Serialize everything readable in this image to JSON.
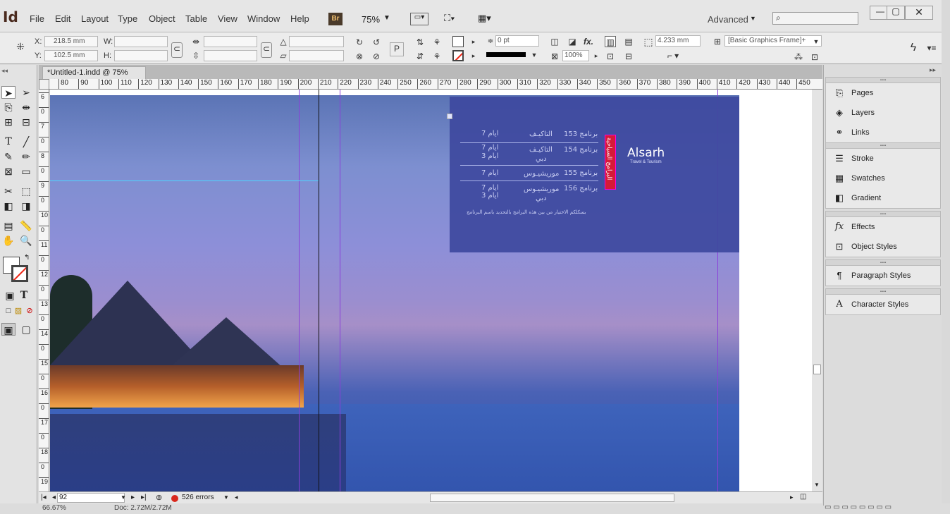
{
  "app": {
    "logo": "Id"
  },
  "menu": [
    "File",
    "Edit",
    "Layout",
    "Type",
    "Object",
    "Table",
    "View",
    "Window",
    "Help"
  ],
  "bridge_label": "Br",
  "zoom": "75%",
  "workspace": "Advanced",
  "control": {
    "x_label": "X:",
    "x_value": "218.5 mm",
    "y_label": "Y:",
    "y_value": "102.5 mm",
    "w_label": "W:",
    "h_label": "H:",
    "stroke_weight": "0 pt",
    "fit_value": "4.233 mm",
    "zoom_percent": "100%",
    "object_style": "[Basic Graphics Frame]+"
  },
  "document_tab": "*Untitled-1.indd @ 75%",
  "ruler": {
    "horizontal": [
      "80",
      "90",
      "100",
      "110",
      "120",
      "130",
      "140",
      "150",
      "160",
      "170",
      "180",
      "190",
      "200",
      "210",
      "220",
      "230",
      "240",
      "250",
      "260",
      "270",
      "280",
      "290",
      "300",
      "310",
      "320",
      "330",
      "340",
      "350",
      "360",
      "370",
      "380",
      "390",
      "400",
      "410",
      "420",
      "430",
      "440",
      "450"
    ],
    "vertical": [
      "6",
      "0",
      "7",
      "0",
      "8",
      "0",
      "9",
      "0",
      "10",
      "0",
      "11",
      "0",
      "12",
      "0",
      "13",
      "0",
      "14",
      "0",
      "15",
      "0",
      "16",
      "0",
      "17",
      "0",
      "18",
      "0",
      "19",
      "0"
    ]
  },
  "artwork": {
    "brand": "Alsarh",
    "brand_sub": "Travel & Tourism",
    "rows": [
      {
        "program": "برنامج 153",
        "place": "التاكيـف",
        "duration": "7 ايام"
      },
      {
        "program": "برنامج 154",
        "place": "التاكيـف",
        "duration": "7 ايام"
      },
      {
        "program": "برنامج 155",
        "place": "موريشيـوس",
        "duration": "7 ايام"
      },
      {
        "program": "برنامج 156",
        "place": "موريشيـوس",
        "duration": "7 ايام"
      }
    ],
    "sub_place": "دبي",
    "sub_duration": "3 ايام",
    "footer": "بسكلكم الاختيار من بين هذه البرامج بالتحديد باسم البرنامج",
    "vertical_title": "البرامج السياحية"
  },
  "pages_field": "92",
  "errors": "526 errors",
  "status": {
    "zoom": "66.67%",
    "doc": "Doc: 2.72M/2.72M"
  },
  "panels": {
    "group1": [
      "Pages",
      "Layers",
      "Links"
    ],
    "group2": [
      "Stroke",
      "Swatches",
      "Gradient"
    ],
    "group3": [
      "Effects",
      "Object Styles"
    ],
    "group4": [
      "Paragraph Styles"
    ],
    "group5": [
      "Character Styles"
    ]
  }
}
